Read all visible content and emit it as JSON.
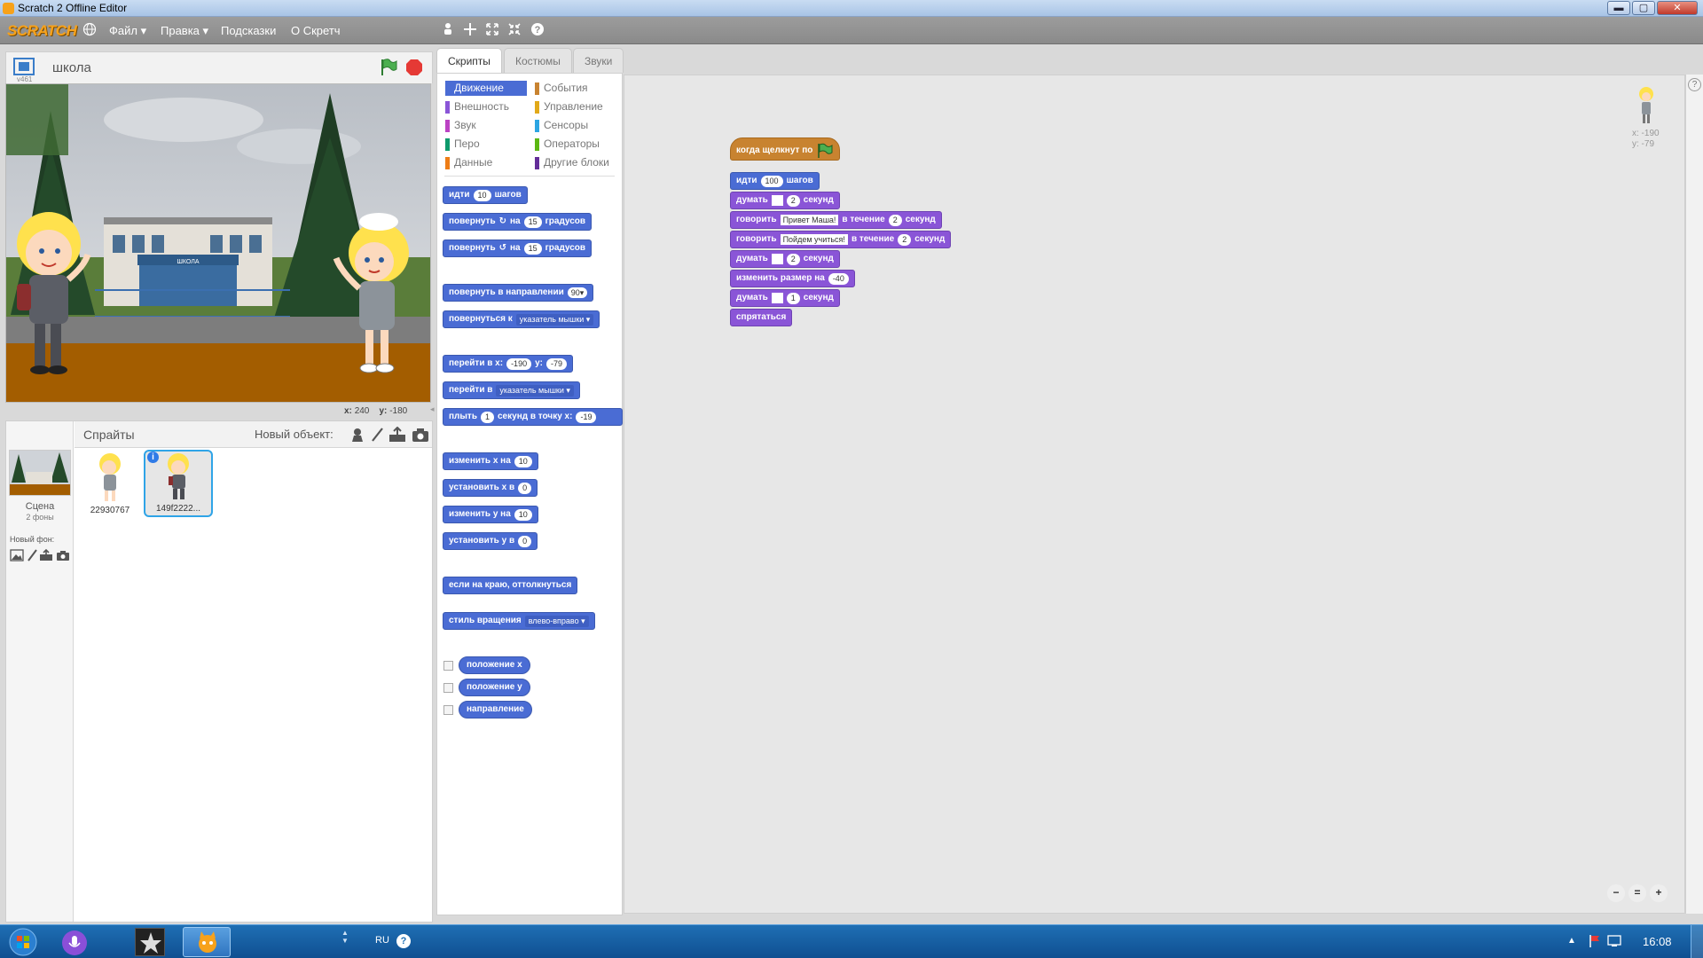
{
  "window": {
    "title": "Scratch 2 Offline Editor",
    "min": "▬",
    "max": "▢",
    "close": "✕"
  },
  "menubar": {
    "logo": "SCRATCH",
    "file": "Файл ▾",
    "edit": "Правка ▾",
    "tips": "Подсказки",
    "about": "О Скретч"
  },
  "stage": {
    "project_name": "школа",
    "version": "v461",
    "coord_x": "240",
    "coord_y": "-180",
    "coord_x_label": "x:",
    "coord_y_label": "y:",
    "school_sign": "ШКОЛА"
  },
  "sprites_pane": {
    "title": "Спрайты",
    "new_object": "Новый объект:",
    "stage_label": "Сцена",
    "stage_backdrops": "2 фоны",
    "new_backdrop": "Новый фон:",
    "sprites": [
      {
        "name": "22930767"
      },
      {
        "name": "149f2222..."
      }
    ],
    "info": "i"
  },
  "tabs": [
    "Скрипты",
    "Костюмы",
    "Звуки"
  ],
  "categories": {
    "left": [
      {
        "label": "Движение",
        "color": "#4a6cd4"
      },
      {
        "label": "Внешность",
        "color": "#8a55d7"
      },
      {
        "label": "Звук",
        "color": "#bb42c3"
      },
      {
        "label": "Перо",
        "color": "#0e9a6c"
      },
      {
        "label": "Данные",
        "color": "#ee7d16"
      }
    ],
    "right": [
      {
        "label": "События",
        "color": "#c88330"
      },
      {
        "label": "Управление",
        "color": "#e1a91a"
      },
      {
        "label": "Сенсоры",
        "color": "#2ca5e2"
      },
      {
        "label": "Операторы",
        "color": "#5cb712"
      },
      {
        "label": "Другие блоки",
        "color": "#632d99"
      }
    ]
  },
  "palette": {
    "move": {
      "a": "идти",
      "n": "10",
      "b": "шагов"
    },
    "turn_right": {
      "a": "повернуть",
      "icon": "↻",
      "b": "на",
      "n": "15",
      "c": "градусов"
    },
    "turn_left": {
      "a": "повернуть",
      "icon": "↺",
      "b": "на",
      "n": "15",
      "c": "градусов"
    },
    "point_dir": {
      "a": "повернуть в направлении",
      "n": "90▾"
    },
    "point_towards": {
      "a": "повернуться к",
      "dd": "указатель мышки ▾"
    },
    "goto_xy": {
      "a": "перейти в x:",
      "x": "-190",
      "b": "y:",
      "y": "-79"
    },
    "goto": {
      "a": "перейти в",
      "dd": "указатель мышки ▾"
    },
    "glide": {
      "a": "плыть",
      "n": "1",
      "b": "секунд в точку x:",
      "x": "-19"
    },
    "change_x": {
      "a": "изменить x на",
      "n": "10"
    },
    "set_x": {
      "a": "установить x в",
      "n": "0"
    },
    "change_y": {
      "a": "изменить y на",
      "n": "10"
    },
    "set_y": {
      "a": "установить y в",
      "n": "0"
    },
    "bounce": {
      "a": "если на краю, оттолкнуться"
    },
    "rotation_style": {
      "a": "стиль вращения",
      "dd": "влево-вправо ▾"
    },
    "rep_x": "положение x",
    "rep_y": "положение y",
    "rep_dir": "направление"
  },
  "script": {
    "hat": "когда щелкнут по",
    "b1": {
      "a": "идти",
      "n": "100",
      "b": "шагов"
    },
    "b2": {
      "a": "думать",
      "n": "2",
      "b": "секунд"
    },
    "b3": {
      "a": "говорить",
      "s": "Привет Маша!",
      "b": "в течение",
      "n": "2",
      "c": "секунд"
    },
    "b4": {
      "a": "говорить",
      "s": "Пойдем учиться!",
      "b": "в течение",
      "n": "2",
      "c": "секунд"
    },
    "b5": {
      "a": "думать",
      "n": "2",
      "b": "секунд"
    },
    "b6": {
      "a": "изменить размер на",
      "n": "-40"
    },
    "b7": {
      "a": "думать",
      "n": "1",
      "b": "секунд"
    },
    "b8": {
      "a": "спрятаться"
    }
  },
  "sprite_info": {
    "x": "x: -190",
    "y": "y: -79"
  },
  "zoom": {
    "out": "−",
    "reset": "=",
    "in": "+"
  },
  "help": "?",
  "taskbar": {
    "lang": "RU",
    "time": "16:08"
  }
}
